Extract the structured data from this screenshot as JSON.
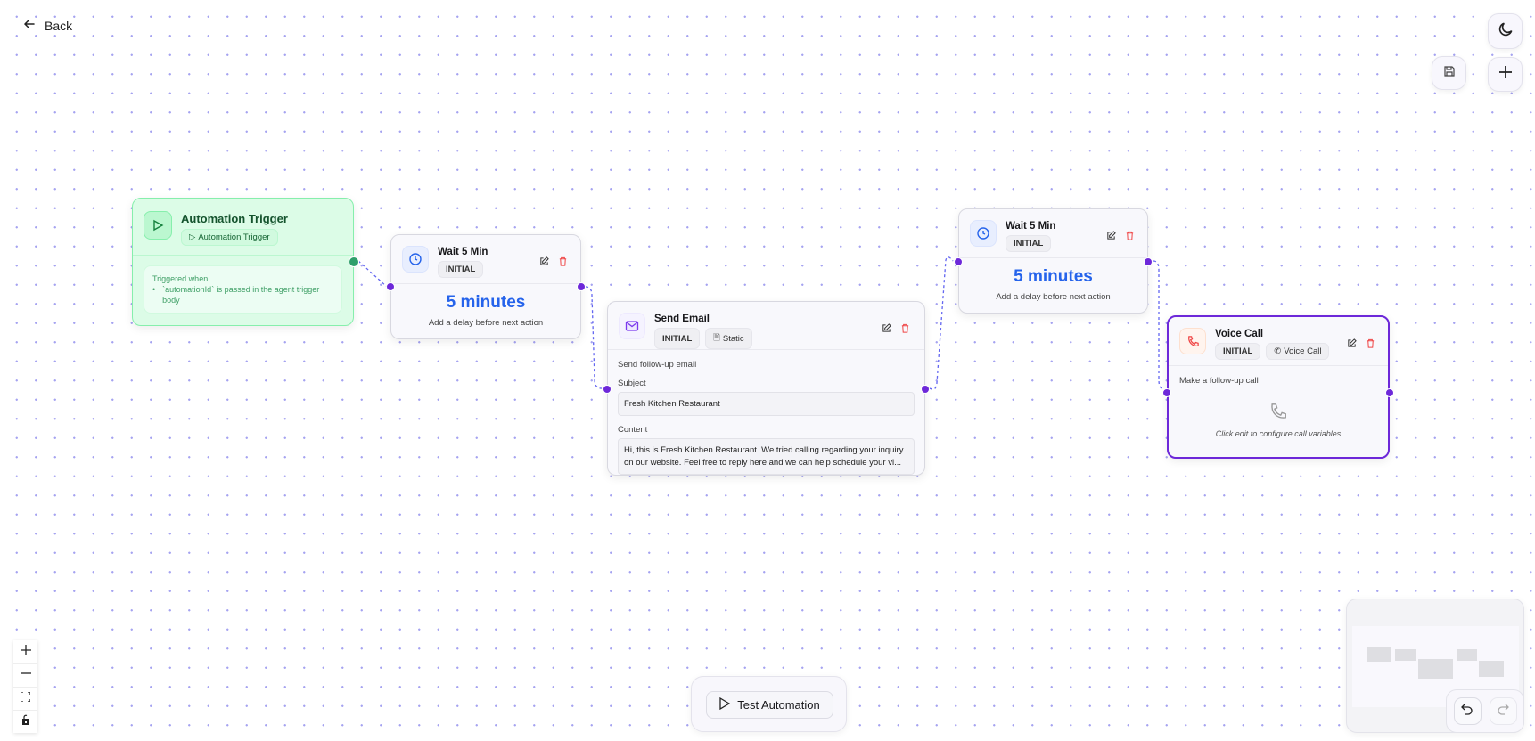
{
  "header": {
    "back_label": "Back"
  },
  "toolbar": {
    "theme_icon": "moon-icon",
    "save_icon": "save-icon",
    "add_icon": "plus-icon"
  },
  "nodes": {
    "trigger": {
      "title": "Automation Trigger",
      "badge": "Automation Trigger",
      "condition_title": "Triggered when:",
      "condition_item": "`automationId` is passed in the agent trigger body",
      "accent": "#16a34a"
    },
    "wait1": {
      "title": "Wait 5 Min",
      "badge": "INITIAL",
      "value": "5 minutes",
      "description": "Add a delay before next action"
    },
    "email": {
      "title": "Send Email",
      "badge": "INITIAL",
      "badge2": "Static",
      "description": "Send follow-up email",
      "subject_label": "Subject",
      "subject_value": "Fresh Kitchen Restaurant",
      "content_label": "Content",
      "content_value": "Hi, this is Fresh Kitchen Restaurant. We tried calling regarding your inquiry on our website. Feel free to reply here and we can help schedule your vi..."
    },
    "wait2": {
      "title": "Wait 5 Min",
      "badge": "INITIAL",
      "value": "5 minutes",
      "description": "Add a delay before next action"
    },
    "voice": {
      "title": "Voice Call",
      "badge": "INITIAL",
      "badge2": "Voice Call",
      "description": "Make a follow-up call",
      "hint": "Click edit to configure call variables",
      "selected_color": "#6d28d9"
    }
  },
  "footer": {
    "test_label": "Test Automation"
  },
  "colors": {
    "edge": "#6366f1",
    "handle": "#6d28d9",
    "delay_value": "#2563eb",
    "delete": "#ef4444"
  }
}
